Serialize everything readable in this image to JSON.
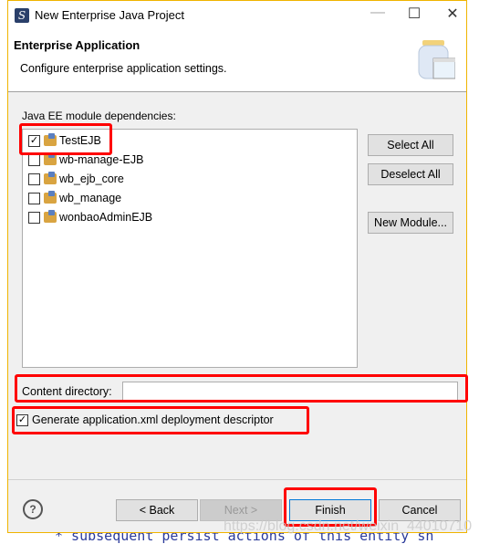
{
  "window": {
    "title": "New Enterprise Java Project",
    "minimize": "—",
    "maximize": "☐",
    "close": "✕"
  },
  "banner": {
    "title": "Enterprise Application",
    "subtitle": "Configure enterprise application settings.",
    "icon": "jar-window-icon"
  },
  "modules": {
    "label": "Java EE module dependencies:",
    "items": [
      {
        "name": "TestEJB",
        "checked": true
      },
      {
        "name": "wb-manage-EJB",
        "checked": false
      },
      {
        "name": "wb_ejb_core",
        "checked": false
      },
      {
        "name": "wb_manage",
        "checked": false
      },
      {
        "name": "wonbaoAdminEJB",
        "checked": false
      }
    ]
  },
  "side_buttons": {
    "select_all": "Select All",
    "deselect_all": "Deselect All",
    "new_module": "New Module..."
  },
  "content_dir": {
    "label": "Content directory:",
    "value": ""
  },
  "generate": {
    "label": "Generate application.xml deployment descriptor",
    "checked": true
  },
  "footer": {
    "help": "?",
    "back": "< Back",
    "next": "Next >",
    "finish": "Finish",
    "cancel": "Cancel"
  },
  "background": {
    "code": "* subsequent persist actions of this entity sh",
    "watermark": "https://blog.csdn.net/weixin_44010710"
  }
}
